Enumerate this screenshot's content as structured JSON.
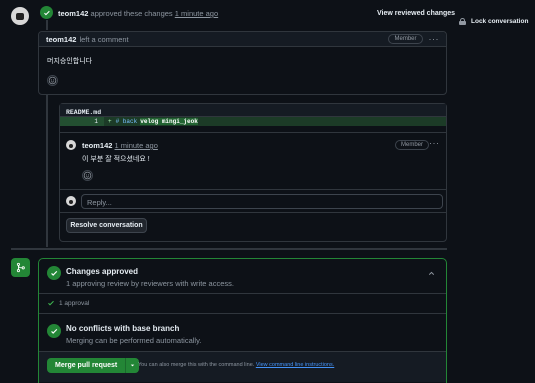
{
  "review": {
    "author": "teom142",
    "action": "approved these changes",
    "time": "1 minute ago",
    "view_label": "View reviewed changes"
  },
  "sidebar": {
    "lock_label": "Lock conversation"
  },
  "comment": {
    "author": "teom142",
    "action": "left a comment",
    "badge": "Member",
    "body": "머지승인합니다"
  },
  "code": {
    "file": "README.md",
    "line_num": "1",
    "sign": "+",
    "hash": "# back",
    "text": "velog mingi_jeok"
  },
  "thread": {
    "author": "teom142",
    "time": "1 minute ago",
    "badge": "Member",
    "body": "이 부분 잘 적으셨네요 !",
    "reply_placeholder": "Reply...",
    "resolve_label": "Resolve conversation"
  },
  "merge": {
    "approved_title": "Changes approved",
    "approved_sub": "1 approving review by reviewers with write access.",
    "approval_count": "1 approval",
    "conflicts_title": "No conflicts with base branch",
    "conflicts_sub": "Merging can be performed automatically.",
    "merge_button": "Merge pull request",
    "hint": "You can also merge this with the command line.",
    "hint_link": "View command line instructions."
  }
}
